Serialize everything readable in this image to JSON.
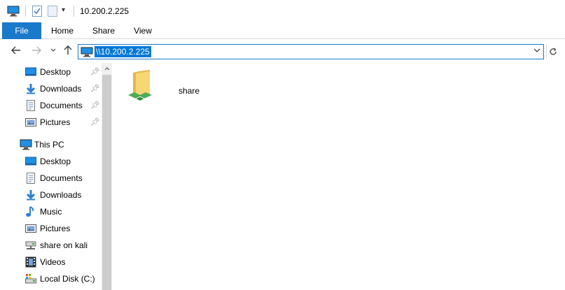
{
  "window": {
    "title": "10.200.2.225"
  },
  "titlebar": {
    "icons": [
      "pc-icon",
      "properties-icon",
      "new-folder-icon",
      "quick-access-dropdown-icon"
    ]
  },
  "ribbon": {
    "tabs": [
      {
        "label": "File",
        "active": true
      },
      {
        "label": "Home"
      },
      {
        "label": "Share"
      },
      {
        "label": "View"
      }
    ]
  },
  "address": {
    "path": "\\\\10.200.2.225"
  },
  "navpane": {
    "quick_access": [
      {
        "label": "Desktop",
        "icon": "desktop-icon",
        "pinned": true
      },
      {
        "label": "Downloads",
        "icon": "downloads-icon",
        "pinned": true
      },
      {
        "label": "Documents",
        "icon": "documents-icon",
        "pinned": true
      },
      {
        "label": "Pictures",
        "icon": "pictures-icon",
        "pinned": true
      }
    ],
    "this_pc_label": "This PC",
    "this_pc_items": [
      {
        "label": "Desktop",
        "icon": "desktop-icon"
      },
      {
        "label": "Documents",
        "icon": "documents-icon"
      },
      {
        "label": "Downloads",
        "icon": "downloads-icon"
      },
      {
        "label": "Music",
        "icon": "music-icon"
      },
      {
        "label": "Pictures",
        "icon": "pictures-icon"
      },
      {
        "label": "share on kali",
        "icon": "network-drive-icon"
      },
      {
        "label": "Videos",
        "icon": "videos-icon"
      },
      {
        "label": "Local Disk (C:)",
        "icon": "local-disk-icon"
      }
    ]
  },
  "content": {
    "items": [
      {
        "label": "share",
        "icon": "shared-folder-icon"
      }
    ]
  },
  "colors": {
    "accent": "#1979ca",
    "selection": "#0078d7"
  }
}
